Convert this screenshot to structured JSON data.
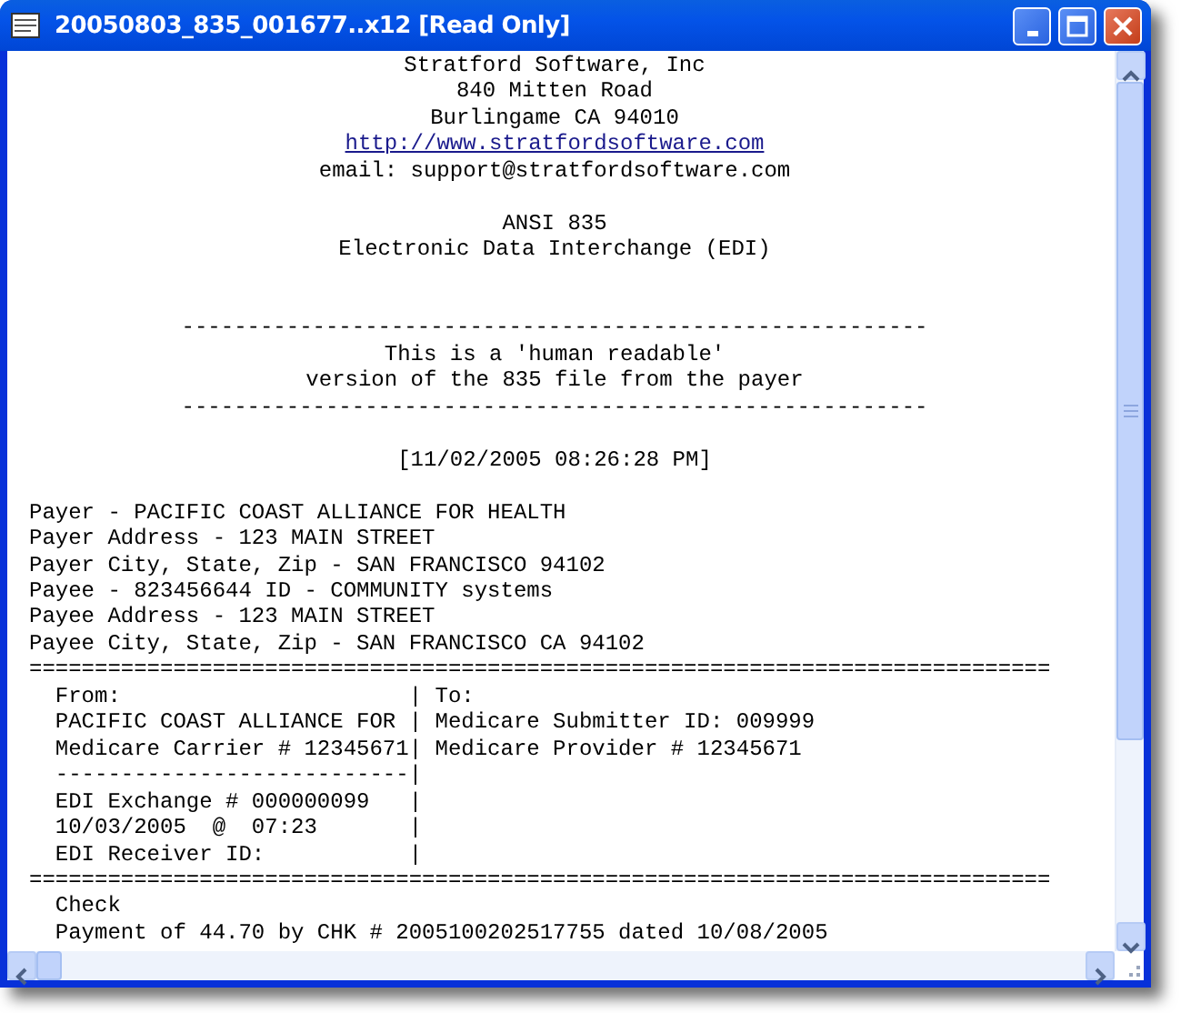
{
  "window": {
    "title": "20050803_835_001677..x12 [Read Only]"
  },
  "document": {
    "lines": [
      {
        "kind": "centered",
        "text": "Stratford Software, Inc"
      },
      {
        "kind": "centered",
        "text": "840 Mitten Road"
      },
      {
        "kind": "centered",
        "text": "Burlingame CA 94010"
      },
      {
        "kind": "link",
        "text": "http://www.stratfordsoftware.com"
      },
      {
        "kind": "centered",
        "text": "email: support@stratfordsoftware.com"
      },
      {
        "kind": "blank"
      },
      {
        "kind": "centered",
        "text": "ANSI 835"
      },
      {
        "kind": "centered",
        "text": "Electronic Data Interchange (EDI)"
      },
      {
        "kind": "blank"
      },
      {
        "kind": "blank"
      },
      {
        "kind": "centered",
        "text": "---------------------------------------------------------"
      },
      {
        "kind": "centered",
        "text": "This is a 'human readable'"
      },
      {
        "kind": "centered",
        "text": "version of the 835 file from the payer"
      },
      {
        "kind": "centered",
        "text": "---------------------------------------------------------"
      },
      {
        "kind": "blank"
      },
      {
        "kind": "centered",
        "text": "[11/02/2005 08:26:28 PM]"
      },
      {
        "kind": "blank"
      },
      {
        "kind": "text",
        "text": "Payer - PACIFIC COAST ALLIANCE FOR HEALTH"
      },
      {
        "kind": "text",
        "text": "Payer Address - 123 MAIN STREET"
      },
      {
        "kind": "text",
        "text": "Payer City, State, Zip - SAN FRANCISCO 94102"
      },
      {
        "kind": "text",
        "text": "Payee - 823456644 ID - COMMUNITY systems"
      },
      {
        "kind": "text",
        "text": "Payee Address - 123 MAIN STREET"
      },
      {
        "kind": "text",
        "text": "Payee City, State, Zip - SAN FRANCISCO CA 94102"
      },
      {
        "kind": "text",
        "text": "=============================================================================="
      },
      {
        "kind": "text",
        "text": "  From:                      | To:"
      },
      {
        "kind": "text",
        "text": "  PACIFIC COAST ALLIANCE FOR | Medicare Submitter ID: 009999"
      },
      {
        "kind": "text",
        "text": "  Medicare Carrier # 12345671| Medicare Provider # 12345671"
      },
      {
        "kind": "text",
        "text": "  ---------------------------|"
      },
      {
        "kind": "text",
        "text": "  EDI Exchange # 000000099   |"
      },
      {
        "kind": "text",
        "text": "  10/03/2005  @  07:23       |"
      },
      {
        "kind": "text",
        "text": "  EDI Receiver ID:           |"
      },
      {
        "kind": "text",
        "text": "=============================================================================="
      },
      {
        "kind": "text",
        "text": "  Check"
      },
      {
        "kind": "text",
        "text": "  Payment of 44.70 by CHK # 2005100202517755 dated 10/08/2005"
      }
    ]
  }
}
